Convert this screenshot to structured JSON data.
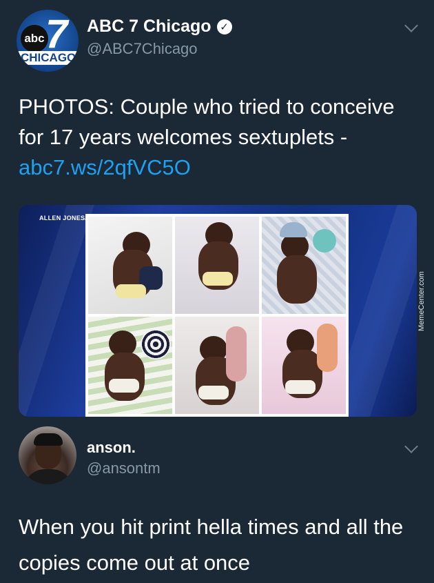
{
  "tweet1": {
    "display_name": "ABC 7 Chicago",
    "handle": "@ABC7Chicago",
    "verified_icon": "verified-badge-icon",
    "avatar": {
      "logo_abc": "abc",
      "logo_seven": "7",
      "logo_city": "CHICAGO"
    },
    "text": "PHOTOS: Couple who tried to conceive for 17 years welcomes sextuplets -",
    "link": "abc7.ws/2qfVC5O",
    "media": {
      "credit": "ALLEN JONES/VCU MARKETING",
      "photo_count": 6
    }
  },
  "watermark": "MemeCenter.com",
  "tweet2": {
    "display_name": "anson.",
    "handle": "@ansontm",
    "text": "When you hit print hella times and all the copies come out at once"
  },
  "colors": {
    "background": "#1b2836",
    "link": "#1da1f2",
    "secondary_text": "#8899a6"
  }
}
